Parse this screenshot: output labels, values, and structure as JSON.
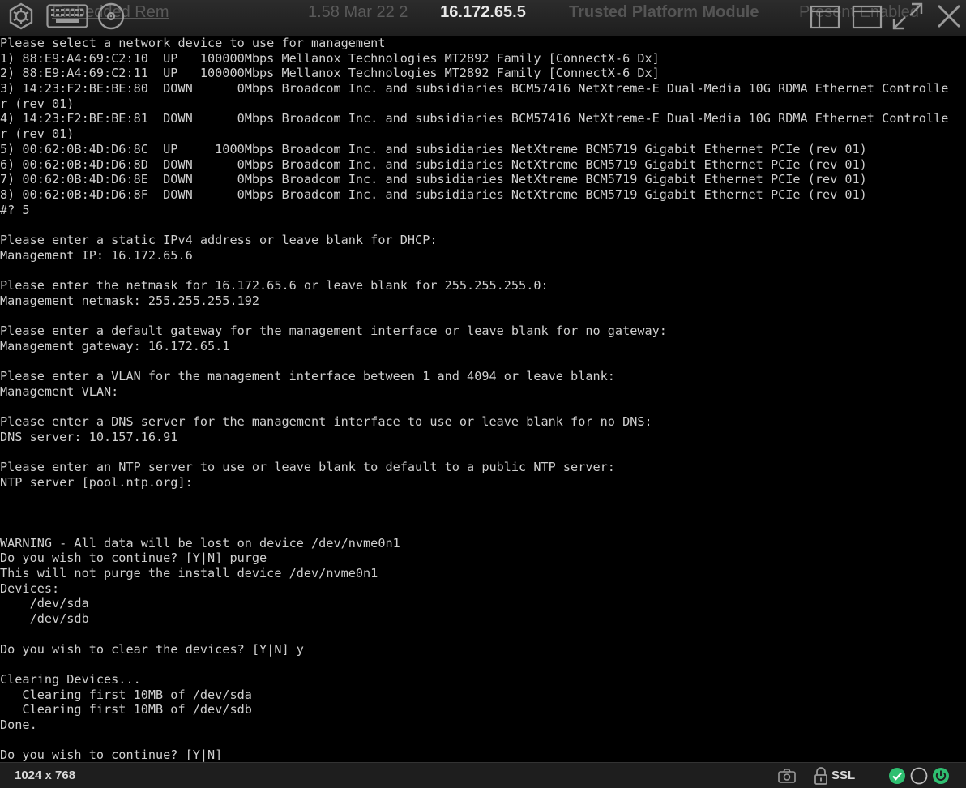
{
  "window": {
    "title": "16.172.65.5",
    "background_text": {
      "left": "Embedded Rem",
      "date": "1.58 Mar 22 2",
      "module": "Trusted Platform Module",
      "status": "Present Enabled"
    },
    "icons": [
      "remote-console-logo-icon",
      "keyboard-icon",
      "virtual-media-disc-icon",
      "restore-window-icon",
      "maximize-window-icon",
      "fullscreen-icon",
      "close-icon"
    ]
  },
  "console": {
    "lines": [
      "Please select a network device to use for management",
      "1) 88:E9:A4:69:C2:10  UP   100000Mbps Mellanox Technologies MT2892 Family [ConnectX-6 Dx]",
      "2) 88:E9:A4:69:C2:11  UP   100000Mbps Mellanox Technologies MT2892 Family [ConnectX-6 Dx]",
      "3) 14:23:F2:BE:BE:80  DOWN      0Mbps Broadcom Inc. and subsidiaries BCM57416 NetXtreme-E Dual-Media 10G RDMA Ethernet Controlle",
      "r (rev 01)",
      "4) 14:23:F2:BE:BE:81  DOWN      0Mbps Broadcom Inc. and subsidiaries BCM57416 NetXtreme-E Dual-Media 10G RDMA Ethernet Controlle",
      "r (rev 01)",
      "5) 00:62:0B:4D:D6:8C  UP     1000Mbps Broadcom Inc. and subsidiaries NetXtreme BCM5719 Gigabit Ethernet PCIe (rev 01)",
      "6) 00:62:0B:4D:D6:8D  DOWN      0Mbps Broadcom Inc. and subsidiaries NetXtreme BCM5719 Gigabit Ethernet PCIe (rev 01)",
      "7) 00:62:0B:4D:D6:8E  DOWN      0Mbps Broadcom Inc. and subsidiaries NetXtreme BCM5719 Gigabit Ethernet PCIe (rev 01)",
      "8) 00:62:0B:4D:D6:8F  DOWN      0Mbps Broadcom Inc. and subsidiaries NetXtreme BCM5719 Gigabit Ethernet PCIe (rev 01)",
      "#? 5",
      "",
      "Please enter a static IPv4 address or leave blank for DHCP:",
      "Management IP: 16.172.65.6",
      "",
      "Please enter the netmask for 16.172.65.6 or leave blank for 255.255.255.0:",
      "Management netmask: 255.255.255.192",
      "",
      "Please enter a default gateway for the management interface or leave blank for no gateway:",
      "Management gateway: 16.172.65.1",
      "",
      "Please enter a VLAN for the management interface between 1 and 4094 or leave blank:",
      "Management VLAN:",
      "",
      "Please enter a DNS server for the management interface to use or leave blank for no DNS:",
      "DNS server: 10.157.16.91",
      "",
      "Please enter an NTP server to use or leave blank to default to a public NTP server:",
      "NTP server [pool.ntp.org]:",
      "",
      "",
      "",
      "WARNING - All data will be lost on device /dev/nvme0n1",
      "Do you wish to continue? [Y|N] purge",
      "This will not purge the install device /dev/nvme0n1",
      "Devices:",
      "    /dev/sda",
      "    /dev/sdb",
      "",
      "Do you wish to clear the devices? [Y|N] y",
      "",
      "Clearing Devices...",
      "   Clearing first 10MB of /dev/sda",
      "   Clearing first 10MB of /dev/sdb",
      "Done.",
      "",
      "Do you wish to continue? [Y|N]"
    ]
  },
  "statusbar": {
    "resolution": "1024 x 768",
    "ssl_label": "SSL",
    "icons": [
      "camera-icon",
      "lock-icon",
      "check-circle-icon",
      "empty-circle-icon",
      "power-icon"
    ],
    "colors": {
      "ok": "#2fbf71",
      "power": "#2fbf71",
      "idle": "#bfbfbf"
    }
  }
}
